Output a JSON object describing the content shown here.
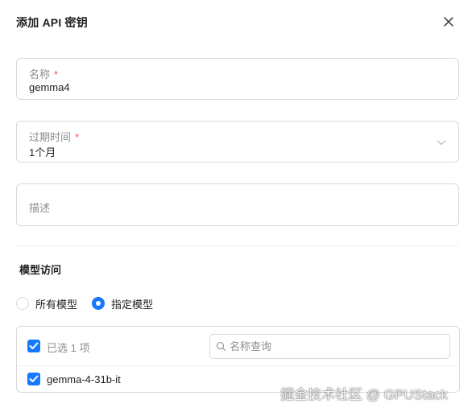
{
  "dialog": {
    "title": "添加 API 密钥"
  },
  "form": {
    "name": {
      "label": "名称",
      "required_mark": "*",
      "value": "gemma4"
    },
    "expiration": {
      "label": "过期时间",
      "required_mark": "*",
      "value": "1个月"
    },
    "description": {
      "placeholder": "描述"
    }
  },
  "model_access": {
    "title": "模型访问",
    "options": [
      {
        "label": "所有模型",
        "checked": false
      },
      {
        "label": "指定模型",
        "checked": true
      }
    ],
    "transfer": {
      "selected_count": "已选 1 项",
      "search_placeholder": "名称查询",
      "items": [
        {
          "label": "gemma-4-31b-it",
          "checked": true
        }
      ]
    }
  },
  "watermark": "掘金技术社区 @ GPUStack",
  "colors": {
    "primary": "#1677ff",
    "required": "#ff4d4f",
    "border": "#d9d9d9",
    "muted_text": "#8c8c8c"
  }
}
